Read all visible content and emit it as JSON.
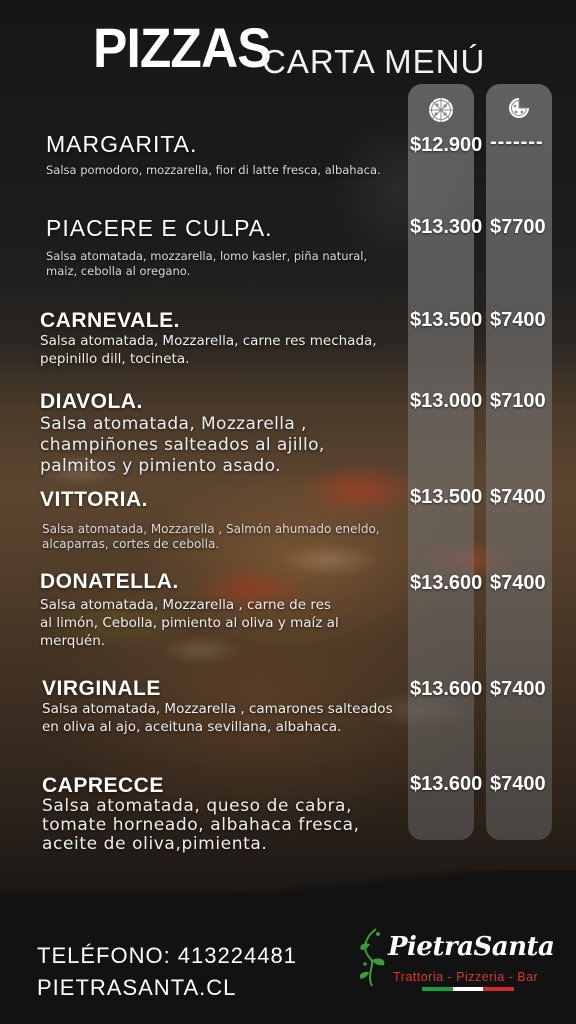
{
  "header": {
    "title": "PIZZAS",
    "subtitle": "CARTA MENÚ"
  },
  "columns": {
    "whole_icon": "whole-pizza-icon",
    "slice_icon": "pizza-slice-icon"
  },
  "items": [
    {
      "name": "MARGARITA.",
      "description": "Salsa pomodoro, mozzarella, fior di latte fresca, albahaca.",
      "price_whole": "$12.900",
      "price_half": "-------"
    },
    {
      "name": "PIACERE E CULPA.",
      "description": "Salsa atomatada, mozzarella, lomo kasler, piña natural, maiz, cebolla al oregano.",
      "price_whole": "$13.300",
      "price_half": "$7700"
    },
    {
      "name": "CARNEVALE.",
      "description": "Salsa atomatada,  Mozzarella, carne res mechada, pepinillo dill, tocineta.",
      "price_whole": "$13.500",
      "price_half": "$7400"
    },
    {
      "name": "DIAVOLA.",
      "description": "Salsa atomatada, Mozzarella , champiñones salteados al ajillo, palmitos y pimiento  asado.",
      "price_whole": "$13.000",
      "price_half": "$7100"
    },
    {
      "name": "VITTORIA.",
      "description": "Salsa atomatada, Mozzarella , Salmón ahumado eneldo, alcaparras, cortes de cebolla.",
      "price_whole": "$13.500",
      "price_half": "$7400"
    },
    {
      "name": "DONATELLA.",
      "description": "Salsa atomatada,  Mozzarella , carne de res al limón,  Cebolla, pimiento al oliva y maíz al  merquén.",
      "price_whole": "$13.600",
      "price_half": "$7400"
    },
    {
      "name": "VIRGINALE",
      "description": "Salsa atomatada,  Mozzarella , camarones salteados en oliva al ajo, aceituna sevillana, albahaca.",
      "price_whole": "$13.600",
      "price_half": "$7400"
    },
    {
      "name": "CAPRECCE",
      "description": "Salsa atomatada, queso de cabra, tomate horneado, albahaca fresca, aceite de oliva,pimienta.",
      "price_whole": "$13.600",
      "price_half": "$7400"
    }
  ],
  "footer": {
    "phone": "TELÉFONO: 413224481",
    "website": "PIETRASANTA.CL",
    "logo_name": "PietraSanta",
    "logo_tagline": "Trattoria - Pizzeria - Bar",
    "flag_colors": [
      "#1f9a3c",
      "#ffffff",
      "#d22a2a"
    ]
  }
}
